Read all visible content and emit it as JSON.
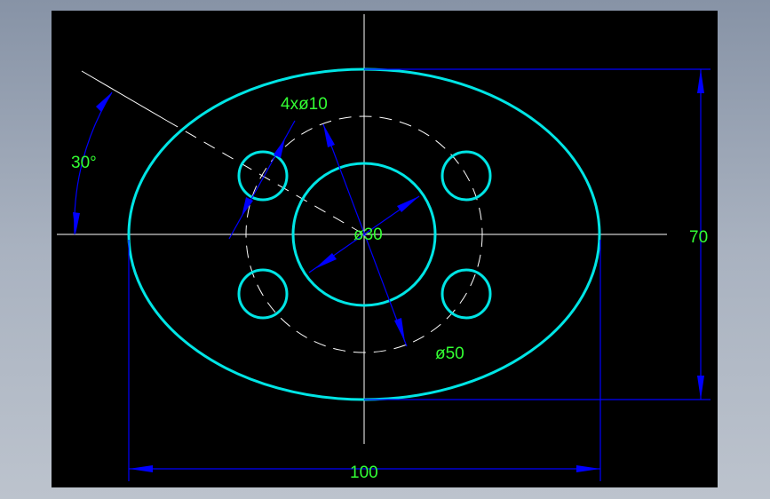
{
  "colors": {
    "background": "#000000",
    "geometry": "#00e5e5",
    "centerline": "#ffffff",
    "dimension": "#0000ff",
    "dimension_text": "#33ff33"
  },
  "labels": {
    "holes": "4xø10",
    "angle": "30°",
    "inner_circle": "ø30",
    "bolt_circle": "ø50",
    "height": "70",
    "width": "100"
  }
}
